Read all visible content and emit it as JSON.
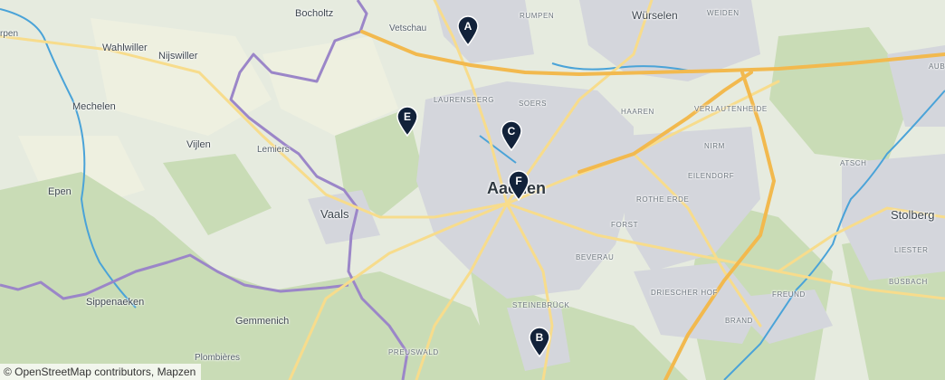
{
  "map": {
    "attribution": "© OpenStreetMap contributors, Mapzen",
    "markers": [
      {
        "id": "A",
        "label": "A"
      },
      {
        "id": "B",
        "label": "B"
      },
      {
        "id": "C",
        "label": "C"
      },
      {
        "id": "E",
        "label": "E"
      },
      {
        "id": "F",
        "label": "F"
      }
    ],
    "places": {
      "aachen": "Aachen",
      "wurselen": "Würselen",
      "stolberg": "Stolberg",
      "vaals": "Vaals",
      "bocholtz": "Bocholtz",
      "vetschau": "Vetschau",
      "wahlwiller": "Wahlwiller",
      "nijswiller": "Nijswiller",
      "mechelen": "Mechelen",
      "vijlen": "Vijlen",
      "lemiers": "Lemiers",
      "epen": "Epen",
      "sippenaeken": "Sippenaeken",
      "gemmenich": "Gemmenich",
      "plombieres": "Plombières",
      "rumpen": "RUMPEN",
      "weiden": "WEIDEN",
      "laurensberg": "LAURENSBERG",
      "soers": "SOERS",
      "haaren": "HAAREN",
      "verlautenheide": "VERLAUTENHEIDE",
      "nirm": "NIRM",
      "eilendorf": "EILENDORF",
      "atsch": "ATSCH",
      "rothe_erde": "ROTHE ERDE",
      "forst": "FORST",
      "beverau": "BEVERAU",
      "driescher_hof": "DRIESCHER HOF",
      "freund": "FREUND",
      "brand": "BRAND",
      "busbach": "BÜSBACH",
      "liester": "LIESTER",
      "steinebruck": "STEINEBRÜCK",
      "preuswald": "PREUSWALD",
      "aub": "AUB",
      "rpen": "rpen"
    },
    "colors": {
      "land": "#e6ebdf",
      "forest": "#c9dcb6",
      "urban": "#d4d6dc",
      "motorway": "#f2b94e",
      "primary": "#f7dc8c",
      "border": "#9b86c8",
      "water": "#4aa3d8",
      "marker": "#12223a"
    }
  }
}
